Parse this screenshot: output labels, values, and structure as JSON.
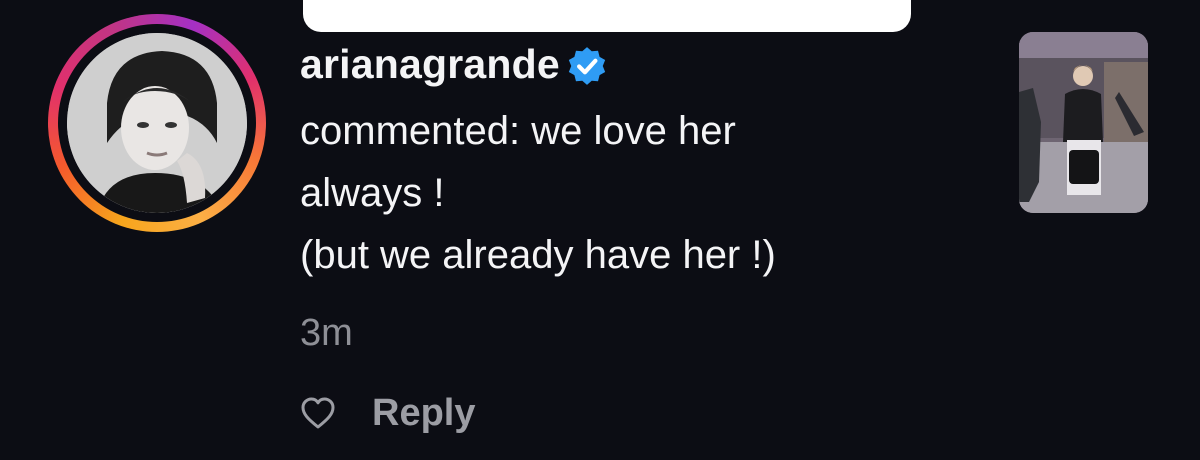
{
  "comment": {
    "username": "arianagrande",
    "verified": true,
    "text": "commented: we love her\nalways !\n(but we already have her !)",
    "timestamp": "3m",
    "reply_label": "Reply"
  },
  "icons": {
    "verified": "verified-badge-icon",
    "like": "heart-outline-icon"
  },
  "colors": {
    "background": "#0c0d14",
    "verified_blue": "#2f9cf4",
    "secondary_text": "#8e8f96",
    "story_ring": [
      "#fcaf45",
      "#f77737",
      "#e1306c",
      "#c13584"
    ]
  }
}
